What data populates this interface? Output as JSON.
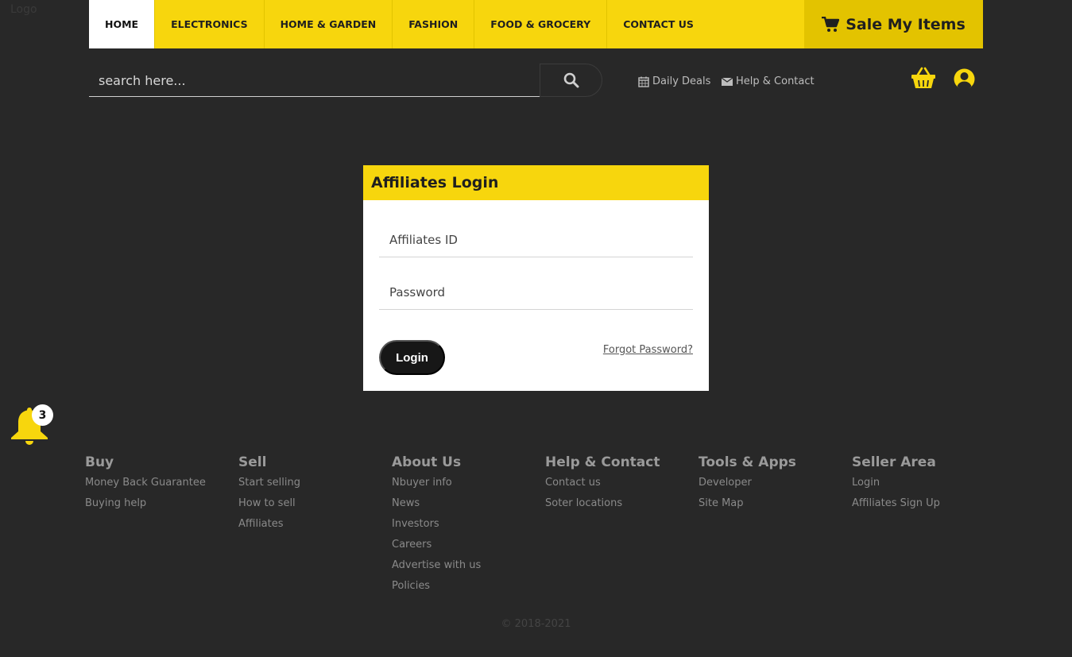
{
  "header": {
    "logo_text": "Logo",
    "nav": [
      {
        "label": "HOME"
      },
      {
        "label": "ELECTRONICS"
      },
      {
        "label": "HOME & GARDEN"
      },
      {
        "label": "FASHION"
      },
      {
        "label": "FOOD & GROCERY"
      },
      {
        "label": "CONTACT US"
      }
    ],
    "sale_label": "Sale My Items"
  },
  "search": {
    "placeholder": "search here...",
    "value": ""
  },
  "quick_links": {
    "daily_deals": "Daily Deals",
    "help_contact": "Help & Contact"
  },
  "login": {
    "title": "Affiliates Login",
    "id_placeholder": "Affiliates ID",
    "password_placeholder": "Password",
    "button": "Login",
    "forgot": "Forgot Password?"
  },
  "notifications": {
    "count": "3"
  },
  "footer": {
    "columns": [
      {
        "title": "Buy",
        "links": [
          "Money Back Guarantee",
          "Buying help"
        ]
      },
      {
        "title": "Sell",
        "links": [
          "Start selling",
          "How to sell",
          "Affiliates"
        ]
      },
      {
        "title": "About Us",
        "links": [
          "Nbuyer info",
          "News",
          "Investors",
          "Careers",
          "Advertise with us",
          "Policies"
        ]
      },
      {
        "title": "Help & Contact",
        "links": [
          "Contact us",
          "Soter locations"
        ]
      },
      {
        "title": "Tools & Apps",
        "links": [
          "Developer",
          "Site Map"
        ]
      },
      {
        "title": "Seller Area",
        "links": [
          "Login",
          "Affiliates Sign Up"
        ]
      }
    ],
    "copyright": "© 2018-2021"
  },
  "colors": {
    "accent": "#f7d60d",
    "accent_dark": "#e3c300",
    "background": "#282828"
  }
}
